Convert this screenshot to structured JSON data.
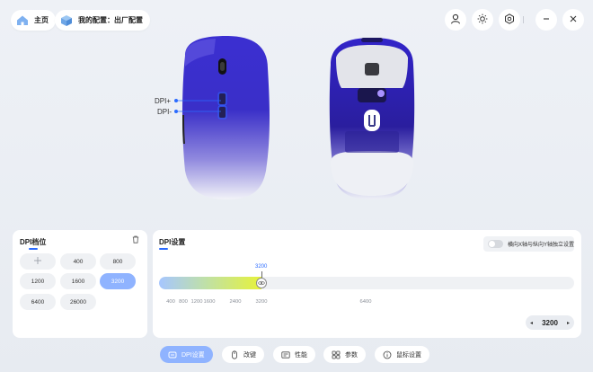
{
  "header": {
    "home_label": "主页",
    "config_label": "我的配置：出厂配置"
  },
  "mouse_view": {
    "button_labels": [
      "DPI+",
      "DPI-"
    ]
  },
  "dpi_levels_panel": {
    "title": "DPI档位",
    "levels": [
      "400",
      "800",
      "1200",
      "1600",
      "3200",
      "6400",
      "26000"
    ],
    "selected": "3200"
  },
  "dpi_settings_panel": {
    "title": "DPI设置",
    "independent_xy_label": "横向X轴与纵向Y轴独立设置",
    "independent_xy_enabled": false,
    "slider": {
      "current_label": "3200",
      "value": 3200,
      "max": 26000,
      "tick_labels": [
        "400",
        "800",
        "1200",
        "1600",
        "2400",
        "3200",
        "6400"
      ]
    },
    "stepper": {
      "value": "3200",
      "decrement": "◂",
      "increment": "▸"
    }
  },
  "bottom_tabs": [
    {
      "label": "DPI设置",
      "icon": "dpi-icon",
      "active": true
    },
    {
      "label": "改键",
      "icon": "mouse-icon",
      "active": false
    },
    {
      "label": "性能",
      "icon": "performance-icon",
      "active": false
    },
    {
      "label": "参数",
      "icon": "grid-icon",
      "active": false
    },
    {
      "label": "鼠标设置",
      "icon": "info-icon",
      "active": false
    }
  ],
  "colors": {
    "accent": "#2b6bff",
    "active_chip": "#8fb3ff",
    "mouse_shell": "#3b2fd1",
    "background": "#eef1f6"
  }
}
